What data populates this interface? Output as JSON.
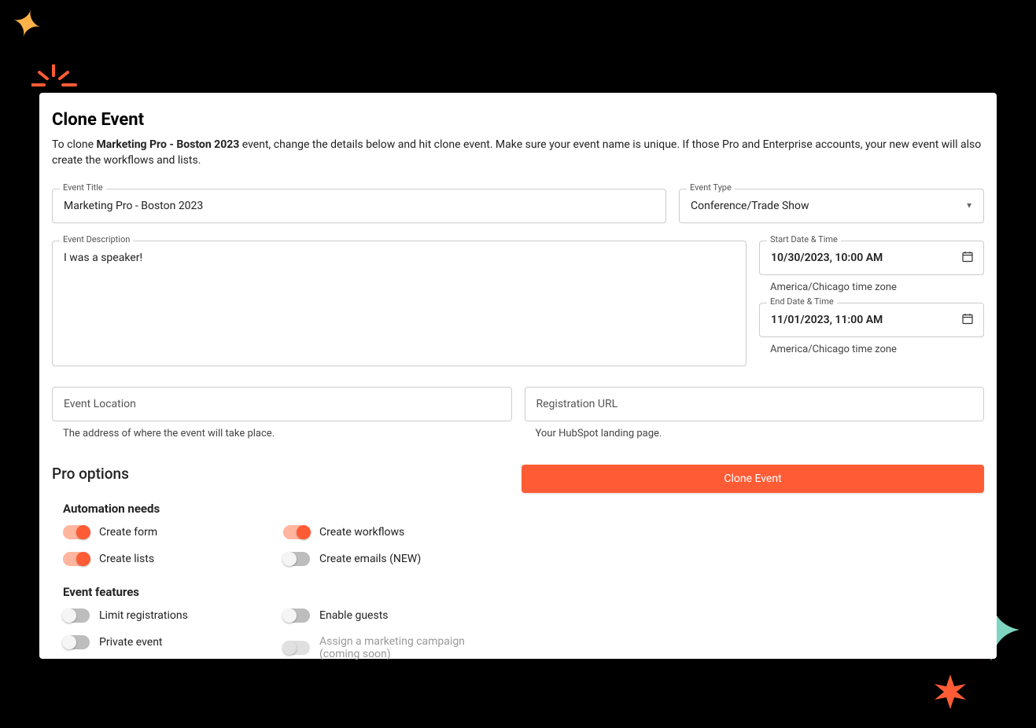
{
  "header": {
    "title": "Clone Event",
    "description_pre": "To clone ",
    "description_bold": "Marketing Pro - Boston 2023",
    "description_post": " event, change the details below and hit clone event. Make sure your event name is unique. If those Pro and Enterprise accounts, your new event will also create the workflows and lists."
  },
  "fields": {
    "event_title": {
      "label": "Event Title",
      "value": "Marketing Pro - Boston 2023"
    },
    "event_type": {
      "label": "Event Type",
      "value": "Conference/Trade Show"
    },
    "event_description": {
      "label": "Event Description",
      "value": "I was a speaker!"
    },
    "start_date": {
      "label": "Start Date & Time",
      "value": "10/30/2023, 10:00 AM",
      "tz": "America/Chicago time zone"
    },
    "end_date": {
      "label": "End Date & Time",
      "value": "11/01/2023, 11:00 AM",
      "tz": "America/Chicago time zone"
    },
    "event_location": {
      "placeholder": "Event Location",
      "helper": "The address of where the event will take place."
    },
    "registration_url": {
      "placeholder": "Registration URL",
      "helper": "Your HubSpot landing page."
    }
  },
  "pro": {
    "title": "Pro options",
    "automation": {
      "heading": "Automation needs",
      "create_form": "Create form",
      "create_lists": "Create lists",
      "create_workflows": "Create workflows",
      "create_emails": "Create emails (NEW)"
    },
    "features": {
      "heading": "Event features",
      "limit_registrations": "Limit registrations",
      "private_event": "Private event",
      "enable_guests": "Enable guests",
      "assign_campaign": "Assign a marketing campaign (coming soon)"
    }
  },
  "actions": {
    "clone_button": "Clone Event"
  }
}
